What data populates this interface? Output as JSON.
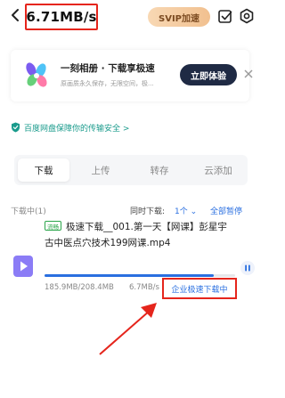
{
  "header": {
    "speed": "6.71MB/s",
    "svip_label": "SVIP加速"
  },
  "promo": {
    "title": "一刻相册 · 下载享极速",
    "subtitle": "原画质永久保存，无限空间，极...",
    "button": "立即体验"
  },
  "security": {
    "text": "百度网盘保障你的传输安全 >"
  },
  "tabs": [
    {
      "label": "下载"
    },
    {
      "label": "上传"
    },
    {
      "label": "转存"
    },
    {
      "label": "云添加"
    }
  ],
  "list": {
    "header": "下载中(1)",
    "concurrent_label": "同时下载:",
    "concurrent_value": "1个 ⌄",
    "pause_all": "全部暂停"
  },
  "item": {
    "tag": "流畅",
    "name": "极速下载__001.第一天【网课】彭星宇古中医点穴技术199网课.mp4",
    "progress": 0.89,
    "size": "185.9MB/208.4MB",
    "rate": "6.7MB/s",
    "accelerate": "企业极速下载中"
  },
  "colors": {
    "highlight_red": "#e5251c",
    "accent_blue": "#2a6fe0",
    "security_teal": "#1a9b8c"
  }
}
